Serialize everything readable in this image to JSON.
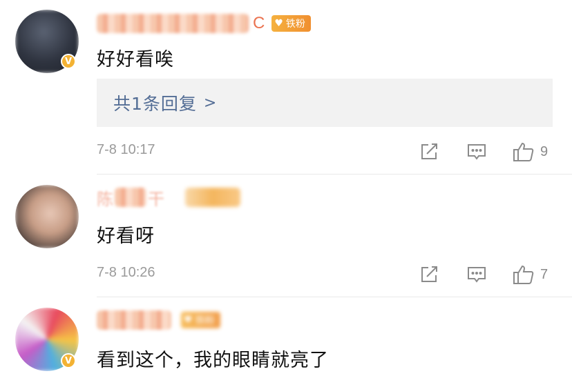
{
  "comments": [
    {
      "username_visible_suffix": "C",
      "fan_badge": "铁粉",
      "text": "好好看唉",
      "reply_link": "共1条回复",
      "reply_chevron": ">",
      "time": "7-8 10:17",
      "likes": "9"
    },
    {
      "username_visible_prefix": "陈",
      "username_visible_suffix": "干",
      "text": "好看呀",
      "time": "7-8 10:26",
      "likes": "7"
    },
    {
      "fan_badge": "铁粉",
      "text": "看到这个，我的眼睛就亮了"
    }
  ],
  "icons": {
    "repost": "repost-icon",
    "comment": "comment-icon",
    "like": "thumbs-up-icon",
    "verified": "verified-v-icon"
  },
  "colors": {
    "username": "#eb7350",
    "reply_link": "#536d95",
    "meta": "#9a9a9a",
    "reply_bg": "#f2f2f2",
    "badge": "#f3b233"
  }
}
